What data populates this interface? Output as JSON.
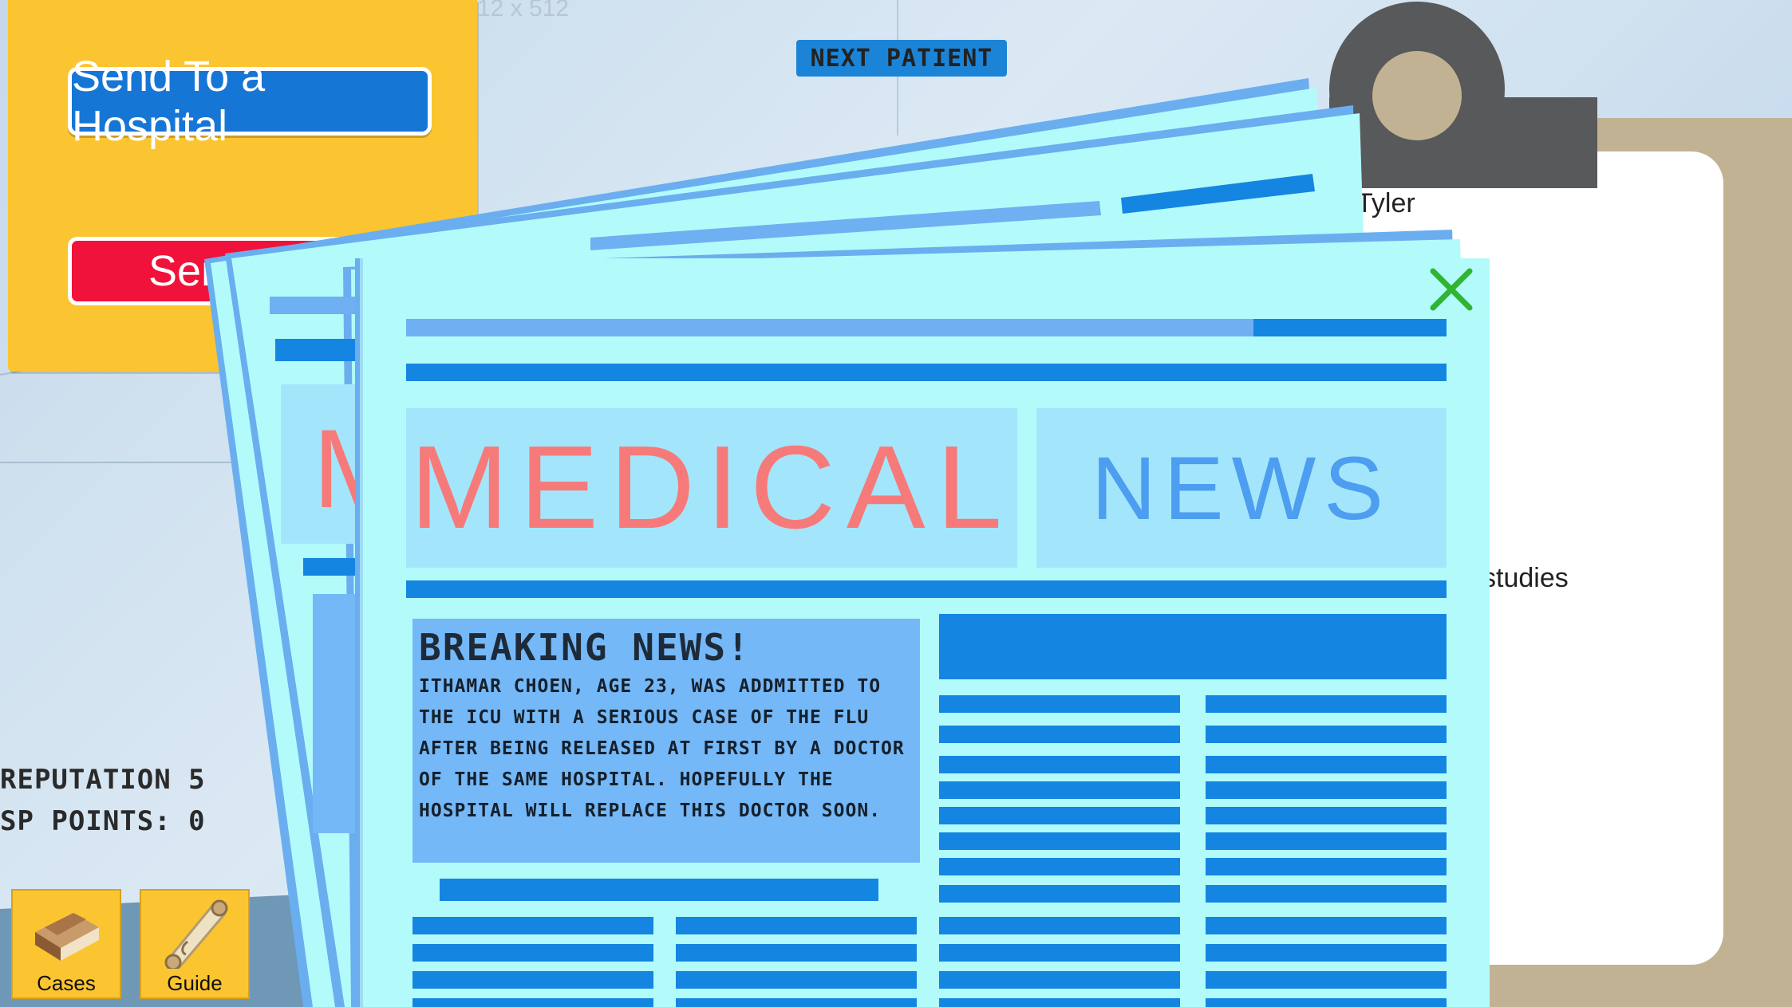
{
  "action_panel": {
    "send_hospital_label": "Send To a Hospital",
    "send_red_label": "Sen"
  },
  "next_patient_label": "NEXT PATIENT",
  "clipboard": {
    "patient_name": "Tyler",
    "partial_text": "studies"
  },
  "stats": {
    "reputation": "REPUTATION 5",
    "sp_points": "SP POINTS: 0"
  },
  "tools": {
    "cases_label": "Cases",
    "guide_label": "Guide"
  },
  "newspaper": {
    "masthead_left": "MEDICAL",
    "masthead_right": "NEWS",
    "back_page_letter": "M",
    "headline": "BREAKING NEWS!",
    "story": "Ithamar Choen, age 23, was addmitted to the ICU with a serious case of the flu after being released at first by a doctor of the same hospital. Hopefully the hospital will replace this doctor soon."
  },
  "background_text": "12 x 512",
  "colors": {
    "panel_yellow": "#fbc531",
    "button_blue": "#1676d6",
    "button_red": "#f0123a",
    "paper_cyan": "#b3fbfb",
    "news_bar_blue": "#1585e2",
    "masthead_red": "#f77a7a",
    "masthead_blue": "#4d9ef0",
    "close_green": "#2fb52f"
  },
  "icons": [
    "close-icon",
    "book-icon",
    "scroll-icon",
    "clip-icon"
  ]
}
